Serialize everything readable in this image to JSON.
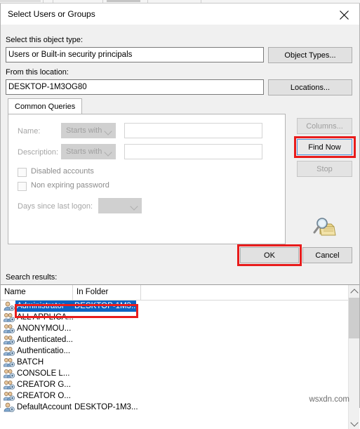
{
  "window": {
    "title": "Select Users or Groups",
    "close_icon": "close-icon"
  },
  "object_type": {
    "label": "Select this object type:",
    "value": "Users or Built-in security principals",
    "button": "Object Types..."
  },
  "location": {
    "label": "From this location:",
    "value": "DESKTOP-1M3OG80",
    "button": "Locations..."
  },
  "tabs": [
    {
      "label": "Common Queries",
      "selected": true
    }
  ],
  "query": {
    "name_label": "Name:",
    "name_operator": "Starts with",
    "name_value": "",
    "description_label": "Description:",
    "description_operator": "Starts with",
    "description_value": "",
    "disabled_accounts_label": "Disabled accounts",
    "disabled_accounts_checked": false,
    "non_expiring_password_label": "Non expiring password",
    "non_expiring_password_checked": false,
    "days_since_logon_label": "Days since last logon:",
    "days_since_logon_value": ""
  },
  "side_buttons": {
    "columns": "Columns...",
    "find_now": "Find Now",
    "stop": "Stop"
  },
  "dialog_buttons": {
    "ok": "OK",
    "cancel": "Cancel"
  },
  "results": {
    "label": "Search results:",
    "columns": [
      "Name",
      "In Folder"
    ],
    "rows": [
      {
        "name": "Administrator",
        "folder": "DESKTOP-1M3...",
        "selected": true,
        "icon": "user-icon"
      },
      {
        "name": "ALL APPLICA...",
        "folder": "",
        "selected": false,
        "icon": "group-icon"
      },
      {
        "name": "ANONYMOU...",
        "folder": "",
        "selected": false,
        "icon": "group-icon"
      },
      {
        "name": "Authenticated...",
        "folder": "",
        "selected": false,
        "icon": "group-icon"
      },
      {
        "name": "Authenticatio...",
        "folder": "",
        "selected": false,
        "icon": "group-icon"
      },
      {
        "name": "BATCH",
        "folder": "",
        "selected": false,
        "icon": "group-icon"
      },
      {
        "name": "CONSOLE L...",
        "folder": "",
        "selected": false,
        "icon": "group-icon"
      },
      {
        "name": "CREATOR G...",
        "folder": "",
        "selected": false,
        "icon": "group-icon"
      },
      {
        "name": "CREATOR O...",
        "folder": "",
        "selected": false,
        "icon": "group-icon"
      },
      {
        "name": "DefaultAccount",
        "folder": "DESKTOP-1M3...",
        "selected": false,
        "icon": "user-icon"
      }
    ]
  },
  "scrollbar": {
    "up_icon": "chevron-up-icon",
    "down_icon": "chevron-down-icon"
  },
  "watermark": "wsxdn.com",
  "colors": {
    "annotation": "#e81c1c",
    "selection": "#0a63c2",
    "dialog_bg": "#f0f0f0"
  }
}
